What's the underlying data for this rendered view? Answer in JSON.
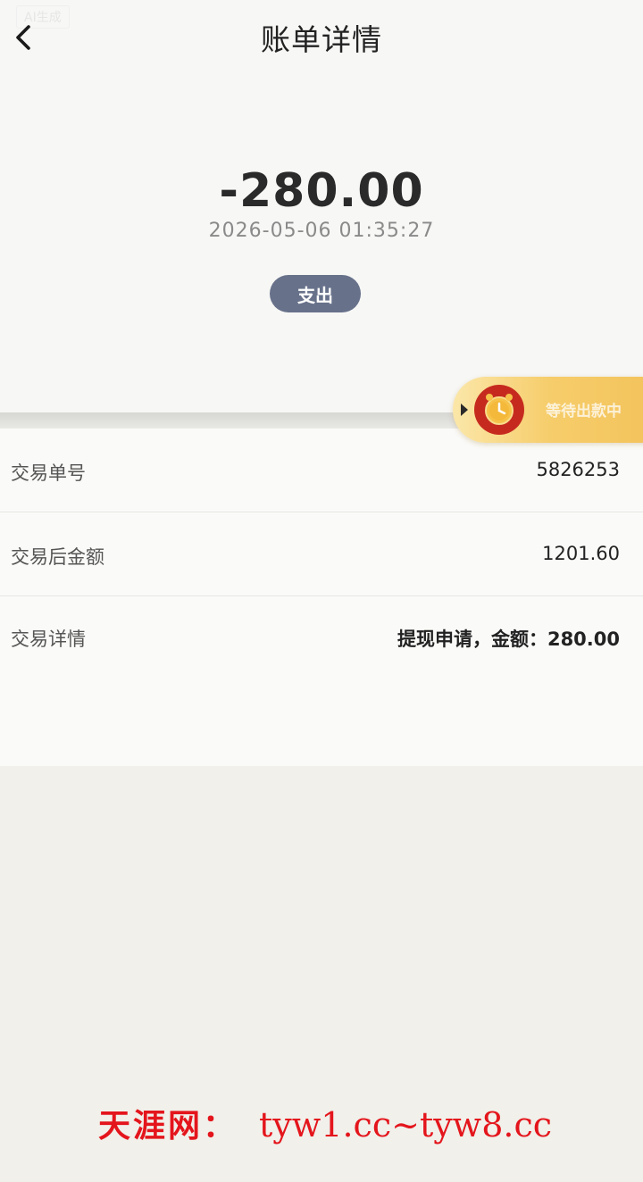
{
  "header": {
    "title": "账单详情",
    "watermark_small": "AI生成"
  },
  "summary": {
    "amount": "-280.00",
    "datetime": "2026-05-06 01:35:27",
    "type_label": "支出"
  },
  "floating_pill": {
    "text": "等待出款中"
  },
  "details": {
    "rows": [
      {
        "label": "交易单号",
        "value": "5826253"
      },
      {
        "label": "交易后金额",
        "value": "1201.60"
      },
      {
        "label": "交易详情",
        "value": "提现申请，金额：280.00"
      }
    ]
  },
  "bottom_watermark": {
    "name": "天涯网：",
    "urls": "tyw1.cc~tyw8.cc"
  },
  "colors": {
    "badge": "#67718a",
    "pill_start": "#fbe7a9",
    "pill_end": "#f3c25a",
    "clock": "#c62a1f",
    "watermark": "#e4151c"
  }
}
